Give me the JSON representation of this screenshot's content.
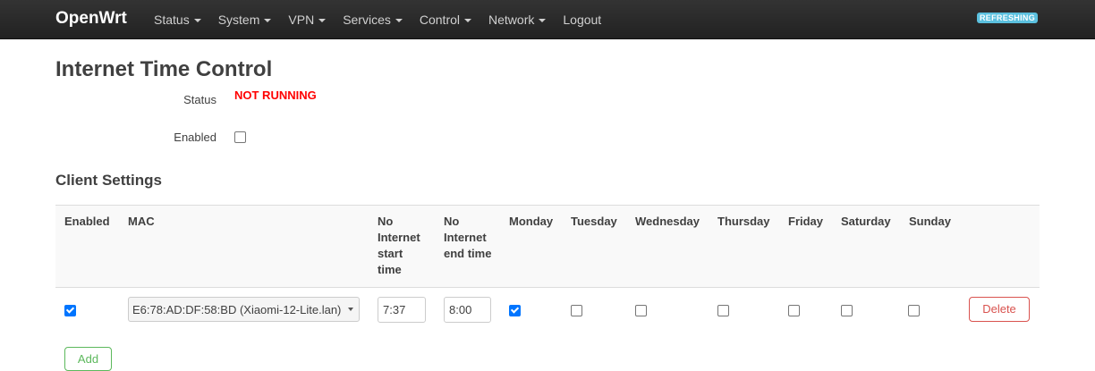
{
  "navbar": {
    "brand": "OpenWrt",
    "menu": [
      "Status",
      "System",
      "VPN",
      "Services",
      "Control",
      "Network",
      "Logout"
    ],
    "refresh_badge": "REFRESHING"
  },
  "page": {
    "title": "Internet Time Control",
    "status_label": "Status",
    "status_value": "NOT RUNNING",
    "enabled_label": "Enabled",
    "enabled_checked": false
  },
  "client_settings": {
    "title": "Client Settings",
    "columns": [
      "Enabled",
      "MAC",
      "No Internet start time",
      "No Internet end time",
      "Monday",
      "Tuesday",
      "Wednesday",
      "Thursday",
      "Friday",
      "Saturday",
      "Sunday"
    ],
    "header_lines": {
      "start_time": [
        "No",
        "Internet",
        "start",
        "time"
      ],
      "end_time": [
        "No",
        "Internet",
        "end time"
      ]
    },
    "rows": [
      {
        "enabled": true,
        "mac": "E6:78:AD:DF:58:BD (Xiaomi-12-Lite.lan)",
        "start_time": "7:37",
        "end_time": "8:00",
        "monday": true,
        "tuesday": false,
        "wednesday": false,
        "thursday": false,
        "friday": false,
        "saturday": false,
        "sunday": false,
        "delete_label": "Delete"
      }
    ],
    "add_label": "Add"
  },
  "colors": {
    "navbar": "#222222",
    "status_red": "#ff0000",
    "refresh_badge": "#5bc0de",
    "delete": "#d9534f",
    "add": "#5cb85c",
    "checkbox_checked": "#0075ff"
  }
}
